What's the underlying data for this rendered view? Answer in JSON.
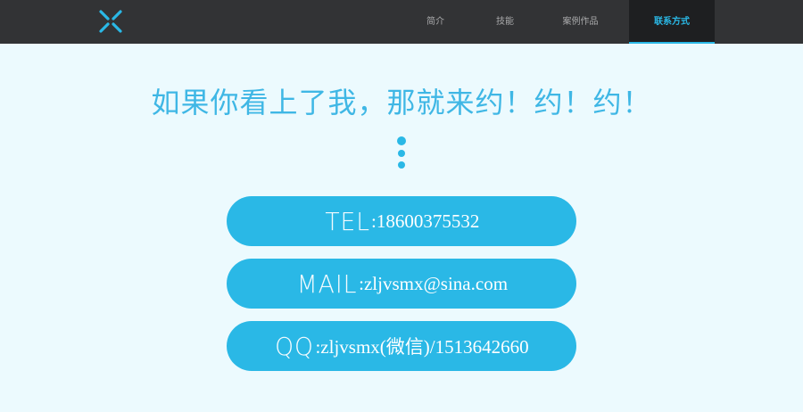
{
  "brand": {
    "logo_icon": "x-logo-icon",
    "accent": "#2ab8e6"
  },
  "nav": {
    "items": [
      {
        "label": "简介"
      },
      {
        "label": "技能"
      },
      {
        "label": "案例作品"
      },
      {
        "label": "联系方式"
      }
    ],
    "active_index": 3
  },
  "hero": {
    "headline": "如果你看上了我，那就来约！约！约！"
  },
  "contacts": {
    "tel": {
      "label": "TEL",
      "value": ":18600375532"
    },
    "mail": {
      "label": "MAIL",
      "value": ":zljvsmx@sina.com"
    },
    "qq": {
      "label": "QQ",
      "value": ":zljvsmx(微信)/1513642660"
    }
  },
  "colors": {
    "navbar_bg": "#323335",
    "page_bg": "#ecfafe",
    "button_bg": "#2ab8e6",
    "headline": "#3fb7e5"
  }
}
